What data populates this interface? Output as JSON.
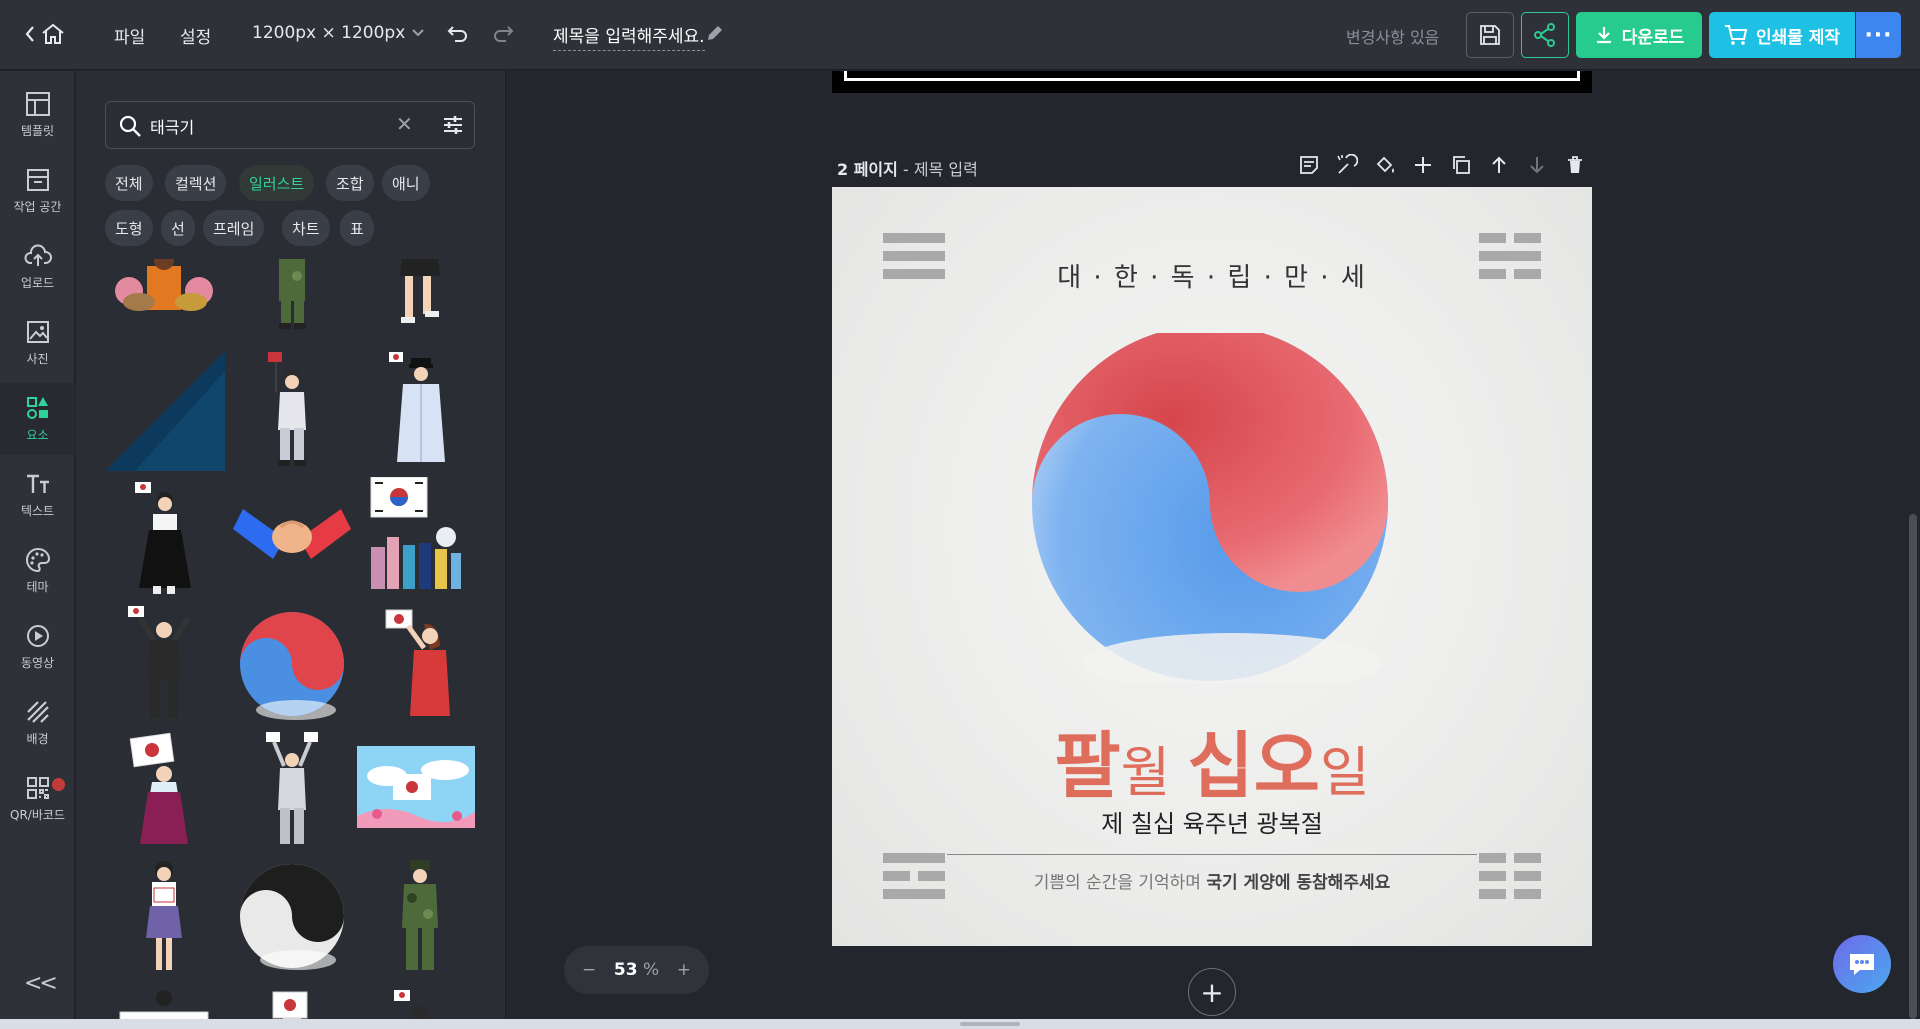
{
  "topbar": {
    "menu_file": "파일",
    "menu_settings": "설정",
    "canvas_size": "1200px × 1200px",
    "title": "제목을 입력해주세요.",
    "changes_status": "변경사항 있음",
    "download_label": "다운로드",
    "print_label": "인쇄물 제작",
    "more_label": "···"
  },
  "rail": {
    "items": [
      {
        "label": "템플릿",
        "icon": "template-icon"
      },
      {
        "label": "작업 공간",
        "icon": "workspace-icon"
      },
      {
        "label": "업로드",
        "icon": "upload-icon"
      },
      {
        "label": "사진",
        "icon": "photo-icon"
      },
      {
        "label": "요소",
        "icon": "elements-icon",
        "active": true
      },
      {
        "label": "텍스트",
        "icon": "text-icon"
      },
      {
        "label": "테마",
        "icon": "palette-icon"
      },
      {
        "label": "동영상",
        "icon": "video-icon"
      },
      {
        "label": "배경",
        "icon": "background-icon"
      },
      {
        "label": "QR/바코드",
        "icon": "qr-icon"
      }
    ],
    "collapse_label": "<<"
  },
  "panel": {
    "search_value": "태극기",
    "chips": [
      {
        "label": "전체"
      },
      {
        "label": "컬렉션"
      },
      {
        "label": "일러스트",
        "active": true
      },
      {
        "label": "조합"
      },
      {
        "label": "애니"
      },
      {
        "label": "도형"
      },
      {
        "label": "선"
      },
      {
        "label": "프레임"
      },
      {
        "label": "차트"
      },
      {
        "label": "표"
      }
    ]
  },
  "canvas": {
    "page_number": "2 페이지",
    "page_sep": " - ",
    "page_title": "제목 입력",
    "mansei": "대 · 한 · 독 · 립 · 만 · 세",
    "date_1": "팔",
    "date_2": "월 ",
    "date_3": "십오",
    "date_4": "일",
    "subtitle": "제 칠십 육주년 광복절",
    "caption_normal": "기쁨의 순간을 기억하며 ",
    "caption_bold": "국기 게양에 동참해주세요",
    "zoom_value": "53",
    "zoom_unit": "%"
  },
  "colors": {
    "accent_green": "#27cb8e",
    "accent_cyan": "#1ec0e3",
    "accent_blue": "#3d86f0",
    "title_red": "#de6d5b"
  }
}
